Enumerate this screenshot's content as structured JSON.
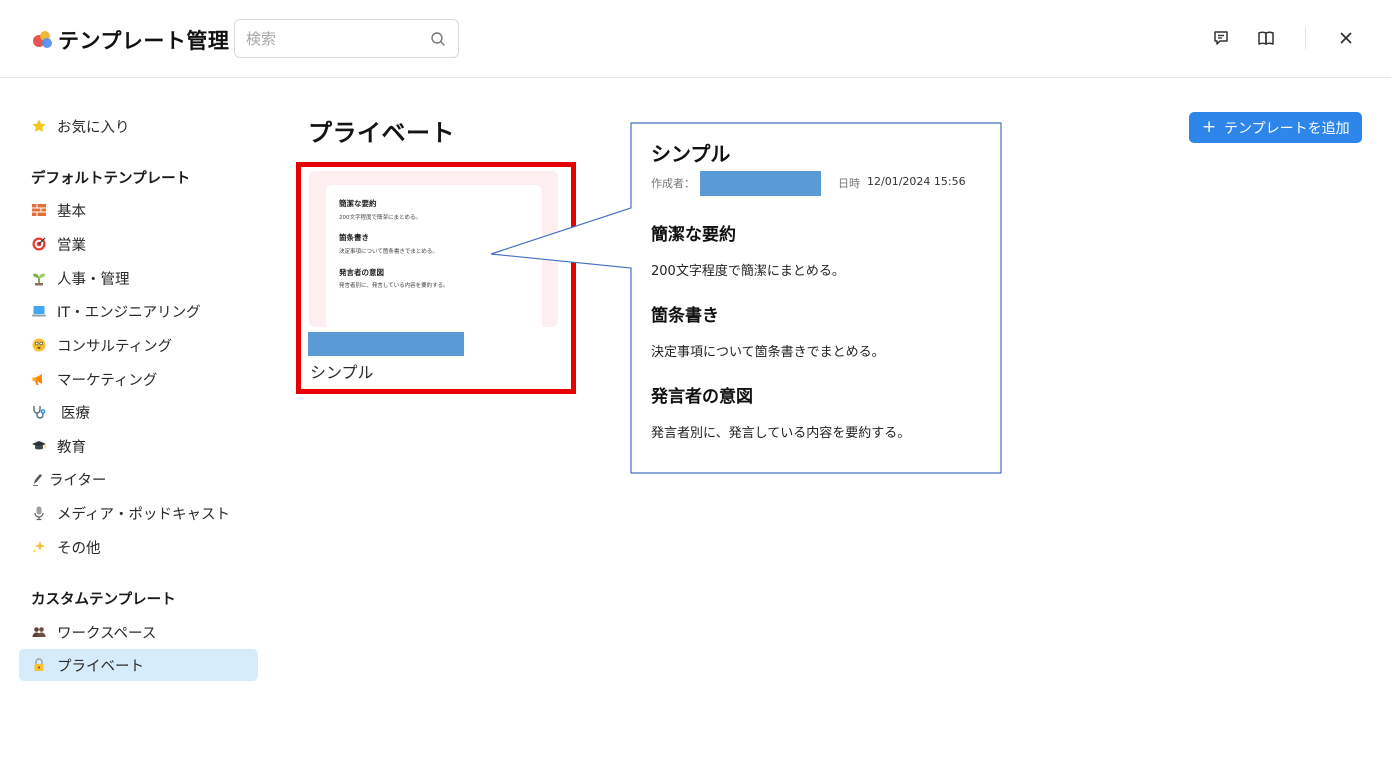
{
  "header": {
    "app_title": "テンプレート管理",
    "search_placeholder": "検索"
  },
  "sidebar": {
    "favorites": {
      "label": "お気に入り",
      "icon": "star-icon"
    },
    "default_title": "デフォルトテンプレート",
    "default_items": [
      {
        "label": "基本",
        "icon": "brick-icon"
      },
      {
        "label": "営業",
        "icon": "target-icon"
      },
      {
        "label": "人事・管理",
        "icon": "seedling-icon"
      },
      {
        "label": "IT・エンジニアリング",
        "icon": "laptop-icon"
      },
      {
        "label": "コンサルティング",
        "icon": "face-icon"
      },
      {
        "label": "マーケティング",
        "icon": "megaphone-icon"
      },
      {
        "label": "医療",
        "icon": "stethoscope-icon"
      },
      {
        "label": "教育",
        "icon": "graduation-cap-icon"
      },
      {
        "label": "ライター",
        "icon": "pen-icon"
      },
      {
        "label": "メディア・ポッドキャスト",
        "icon": "microphone-icon"
      },
      {
        "label": "その他",
        "icon": "sparkles-icon"
      }
    ],
    "custom_title": "カスタムテンプレート",
    "custom_items": [
      {
        "label": "ワークスペース",
        "icon": "people-icon"
      },
      {
        "label": "プライベート",
        "icon": "lock-icon",
        "active": true
      }
    ]
  },
  "main": {
    "page_title": "プライベート",
    "add_button": "テンプレートを追加"
  },
  "card": {
    "name": "シンプル",
    "thumbnail": {
      "sections": [
        {
          "heading": "簡潔な要約",
          "text": "200文字程度で簡潔にまとめる。"
        },
        {
          "heading": "箇条書き",
          "text": "決定事項について箇条書きでまとめる。"
        },
        {
          "heading": "発言者の意図",
          "text": "発言者別に、発言している内容を要約する。"
        }
      ]
    }
  },
  "callout": {
    "title": "シンプル",
    "author_label": "作成者：",
    "date_label": "日時",
    "date_value": "12/01/2024 15:56",
    "sections": [
      {
        "heading": "簡潔な要約",
        "text": "200文字程度で簡潔にまとめる。"
      },
      {
        "heading": "箇条書き",
        "text": "決定事項について箇条書きでまとめる。"
      },
      {
        "heading": "発言者の意図",
        "text": "発言者別に、発言している内容を要約する。"
      }
    ]
  },
  "colors": {
    "accent": "#2f86ea",
    "redaction": "#5b9bd5",
    "highlight": "#e60000",
    "callout_border": "#4472c4",
    "active_nav": "#d7ecfa"
  }
}
